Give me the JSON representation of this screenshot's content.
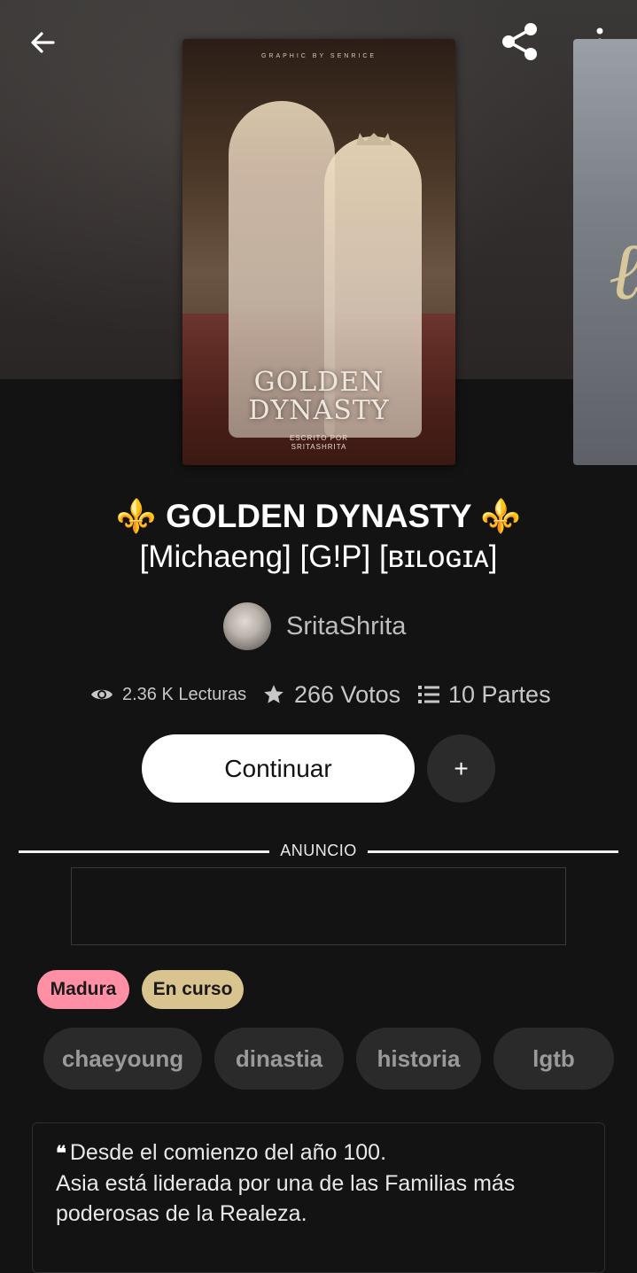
{
  "story": {
    "cover": {
      "credit": "GRAPHIC BY SENRICE",
      "title_line1": "GOLDEN",
      "title_line2": "DYNASTY",
      "sub_line1": "ESCRITO POR",
      "sub_line2": "SRITASHRITA"
    },
    "title_line1": "⚜️ GOLDEN DYNASTY ⚜️",
    "title_line2": "[Michaeng] [G!P] [ʙɪʟᴏɢɪᴀ]",
    "author": "SritaShrita",
    "stats": {
      "reads": "2.36 K Lecturas",
      "votes": "266 Votos",
      "parts": "10 Partes"
    }
  },
  "actions": {
    "continue_label": "Continuar",
    "add_label": "+"
  },
  "ad": {
    "label": "ANUNCIO"
  },
  "badges": {
    "mature": "Madura",
    "status": "En curso"
  },
  "tags": [
    "chaeyoung",
    "dinastia",
    "historia",
    "lgtb"
  ],
  "description": {
    "quote_mark": "❝",
    "line1": "Desde el comienzo del año 100.",
    "line2": "Asia está liderada por una de las Familias más",
    "line3": "poderosas de la Realeza."
  },
  "icons": [
    "arrow-left-icon",
    "share-icon",
    "more-vertical-icon",
    "eye-icon",
    "star-icon",
    "list-icon"
  ],
  "colors": {
    "background": "#131313",
    "mature_badge": "#ff8fa4",
    "status_badge": "#d9c38e",
    "tag_bg": "#2a2a2a"
  }
}
